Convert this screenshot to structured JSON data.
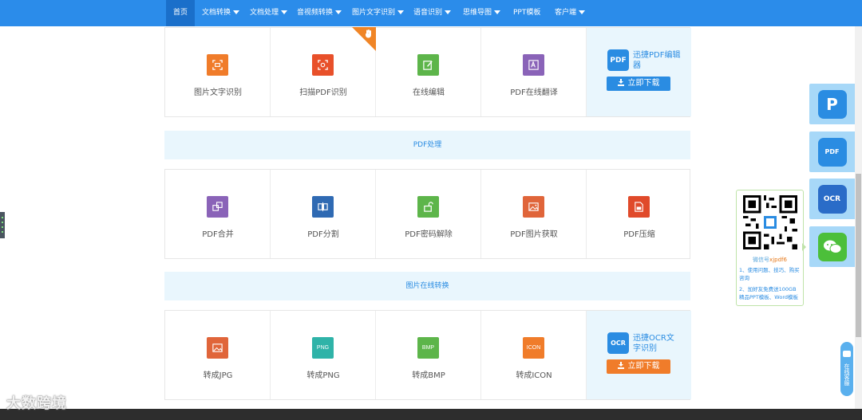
{
  "nav": {
    "items": [
      {
        "label": "首页",
        "dropdown": false
      },
      {
        "label": "文档转换",
        "dropdown": true
      },
      {
        "label": "文档处理",
        "dropdown": true
      },
      {
        "label": "音视频转换",
        "dropdown": true
      },
      {
        "label": "图片文字识别",
        "dropdown": true
      },
      {
        "label": "语音识别",
        "dropdown": true
      },
      {
        "label": "思维导图",
        "dropdown": true
      },
      {
        "label": "PPT模板",
        "dropdown": false
      },
      {
        "label": "客户端",
        "dropdown": true
      }
    ]
  },
  "row1": {
    "items": [
      {
        "label": "图片文字识别",
        "icon": "image-scan-icon",
        "color": "#f07c2a"
      },
      {
        "label": "扫描PDF识别",
        "icon": "scan-icon",
        "color": "#e8502a"
      },
      {
        "label": "在线编辑",
        "icon": "edit-icon",
        "color": "#5db54a"
      },
      {
        "label": "PDF在线翻译",
        "icon": "translate-icon",
        "color": "#8a63b8"
      }
    ],
    "promo": {
      "name": "迅捷PDF编辑器",
      "button": "立即下载",
      "logo": "PDF",
      "button_color": "#2a8ce2"
    }
  },
  "section_pdf": {
    "title": "PDF处理"
  },
  "row2": {
    "items": [
      {
        "label": "PDF合并",
        "icon": "merge-icon",
        "color": "#8a63b8"
      },
      {
        "label": "PDF分割",
        "icon": "split-icon",
        "color": "#2f6ab3"
      },
      {
        "label": "PDF密码解除",
        "icon": "unlock-icon",
        "color": "#5db54a"
      },
      {
        "label": "PDF图片获取",
        "icon": "image-icon",
        "color": "#e0653a"
      },
      {
        "label": "PDF压缩",
        "icon": "compress-icon",
        "color": "#e04a2a"
      }
    ]
  },
  "section_img": {
    "title": "图片在线转换"
  },
  "row3": {
    "items": [
      {
        "label": "转成JPG",
        "icon": "jpg-icon",
        "color": "#e0653a",
        "text": ""
      },
      {
        "label": "转成PNG",
        "icon": "png-icon",
        "color": "#2fb3a8",
        "text": "PNG"
      },
      {
        "label": "转成BMP",
        "icon": "bmp-icon",
        "color": "#5db54a",
        "text": "BMP"
      },
      {
        "label": "转成ICON",
        "icon": "icon-format-icon",
        "color": "#f07c2a",
        "text": "ICON"
      }
    ],
    "promo": {
      "name": "迅捷OCR文字识别",
      "button": "立即下载",
      "logo": "OCR",
      "button_color": "#f07c2a"
    }
  },
  "sidebar": {
    "items": [
      {
        "name": "pdf-reader-icon",
        "label": "P",
        "color": "#2a8ce2"
      },
      {
        "name": "pdf-editor-icon",
        "label": "PDF",
        "color": "#2a8ce2"
      },
      {
        "name": "ocr-icon",
        "label": "OCR",
        "color": "#2a6cc8"
      },
      {
        "name": "wechat-icon",
        "label": "",
        "color": "#4cbf3a"
      }
    ]
  },
  "qr": {
    "wechat_prefix": "微信号",
    "wechat_id": "xjpdf6",
    "line1": "1、使用问题、技巧、购买咨询",
    "line2_a": "2、加好友免费送100GB",
    "line2_b": "精品PPT模板、Word模板"
  },
  "kefu": {
    "label": "在线客服"
  },
  "watermark": {
    "text": "大数跨境"
  }
}
